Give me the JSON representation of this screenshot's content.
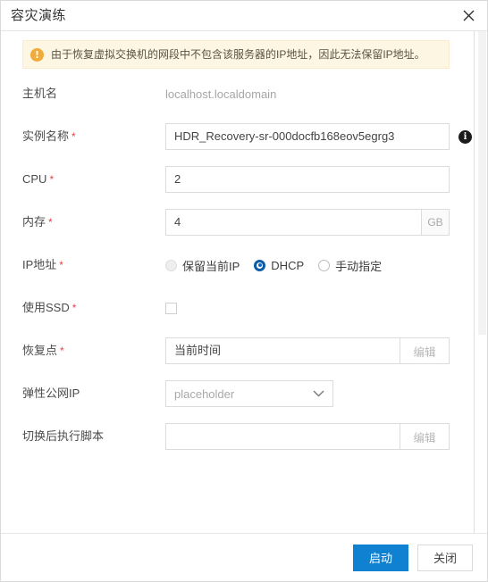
{
  "dialog": {
    "title": "容灾演练",
    "close_icon": "close-icon"
  },
  "alert": {
    "icon": "warning-icon",
    "text": "由于恢复虚拟交换机的网段中不包含该服务器的IP地址，因此无法保留IP地址。"
  },
  "form": {
    "hostname": {
      "label": "主机名",
      "value": "localhost.localdomain"
    },
    "instance_name": {
      "label": "实例名称",
      "required": "*",
      "value": "HDR_Recovery-sr-000docfb168eov5egrg3",
      "info_icon": "info-icon"
    },
    "cpu": {
      "label": "CPU",
      "required": "*",
      "value": "2"
    },
    "memory": {
      "label": "内存",
      "required": "*",
      "value": "4",
      "unit": "GB"
    },
    "ip_address": {
      "label": "IP地址",
      "required": "*",
      "options": [
        {
          "label": "保留当前IP",
          "selected": false,
          "disabled": true
        },
        {
          "label": "DHCP",
          "selected": true,
          "disabled": false
        },
        {
          "label": "手动指定",
          "selected": false,
          "disabled": false
        }
      ]
    },
    "use_ssd": {
      "label": "使用SSD",
      "required": "*",
      "checked": false
    },
    "recovery_point": {
      "label": "恢复点",
      "required": "*",
      "value": "当前时间",
      "edit_label": "编辑"
    },
    "elastic_ip": {
      "label": "弹性公网IP",
      "placeholder": "placeholder",
      "chevron_icon": "chevron-down-icon"
    },
    "post_switch_script": {
      "label": "切换后执行脚本",
      "value": "",
      "edit_label": "编辑"
    }
  },
  "footer": {
    "primary_label": "启动",
    "close_label": "关闭"
  },
  "colors": {
    "primary": "#1080d0",
    "required": "#e24545",
    "alert_bg": "#fdf6e3",
    "alert_icon": "#f0ab3a",
    "radio_selected": "#0a5ca8"
  }
}
